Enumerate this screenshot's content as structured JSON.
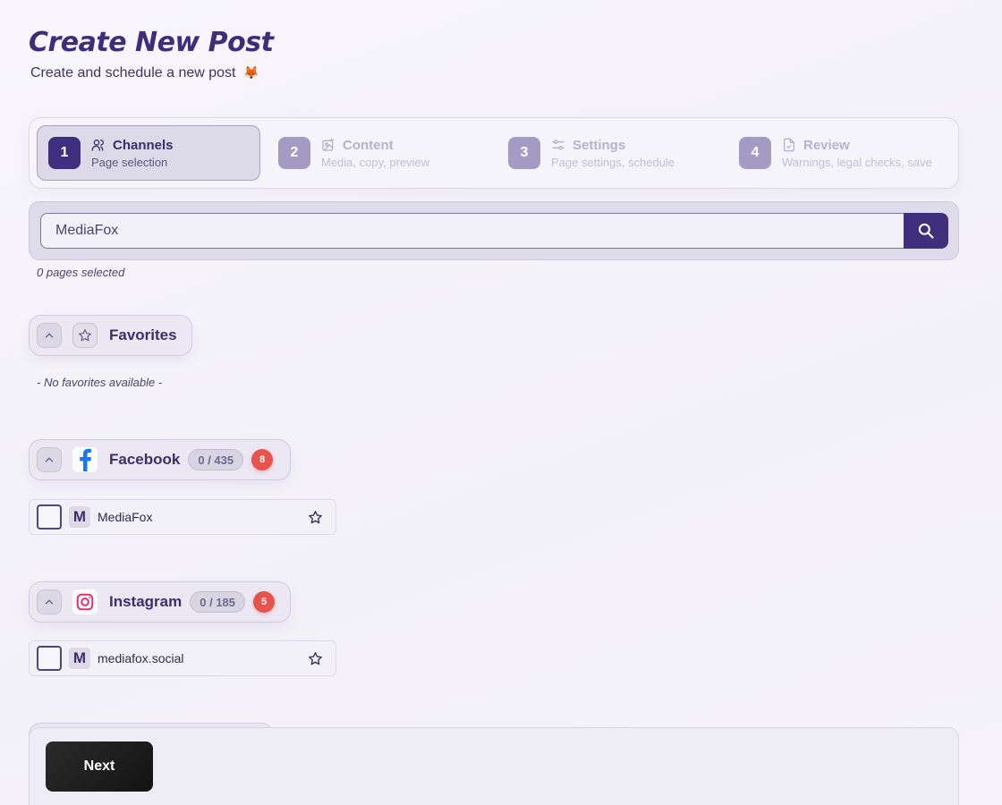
{
  "header": {
    "title": "Create New Post",
    "subtitle": "Create and schedule a new post",
    "subtitle_emoji": "🦊"
  },
  "stepper": {
    "steps": [
      {
        "number": "1",
        "title": "Channels",
        "description": "Page selection",
        "icon": "users-icon",
        "active": true
      },
      {
        "number": "2",
        "title": "Content",
        "description": "Media, copy, preview",
        "icon": "image-sparkle-icon",
        "active": false
      },
      {
        "number": "3",
        "title": "Settings",
        "description": "Page settings, schedule",
        "icon": "sliders-icon",
        "active": false
      },
      {
        "number": "4",
        "title": "Review",
        "description": "Warnings, legal checks, save",
        "icon": "document-check-icon",
        "active": false
      }
    ]
  },
  "search": {
    "value": "MediaFox",
    "button_icon": "search-icon"
  },
  "selection": {
    "summary": "0 pages selected"
  },
  "favorites": {
    "label": "Favorites",
    "empty_text": "- No favorites available -"
  },
  "groups": [
    {
      "label": "Facebook",
      "count": "0 / 435",
      "badge": "8",
      "icon": "facebook-icon",
      "brand_color": "#1877f2",
      "pages": [
        {
          "initial": "M",
          "name": "MediaFox"
        }
      ]
    },
    {
      "label": "Instagram",
      "count": "0 / 185",
      "badge": "5",
      "icon": "instagram-icon",
      "brand_color": "#e1306c",
      "pages": [
        {
          "initial": "M",
          "name": "mediafox.social"
        }
      ]
    }
  ],
  "footer": {
    "next_label": "Next"
  },
  "colors": {
    "accent": "#3f2f7c",
    "badge_red": "#e8544d"
  }
}
